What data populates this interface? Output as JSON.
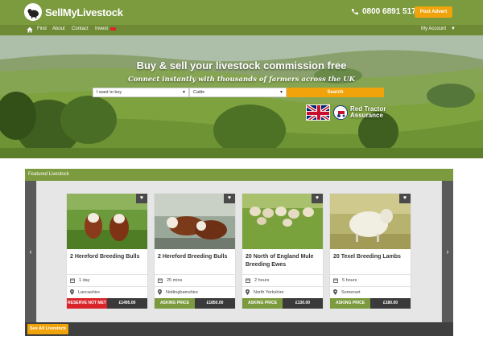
{
  "brand": {
    "name": "SellMyLivestock"
  },
  "header": {
    "phone": "0800 6891 517",
    "post_advert": "Post Advert"
  },
  "nav": {
    "items": [
      {
        "label": "Find"
      },
      {
        "label": "About"
      },
      {
        "label": "Contact"
      },
      {
        "label": "Invest"
      }
    ],
    "account": "My Account"
  },
  "hero": {
    "title": "Buy & sell your livestock commission free",
    "subtitle": "Connect instantly with thousands of farmers across the UK",
    "intent_value": "I want to buy",
    "type_value": "Cattle",
    "search_label": "Search",
    "badge_text": "Red Tractor\nAssurance"
  },
  "featured": {
    "heading": "Featured Livestock",
    "see_all": "See All Livestock",
    "cards": [
      {
        "title": "2 Hereford Breeding Bulls",
        "time": "1 day",
        "location": "Lancashire",
        "price_type": "RESERVE NOT MET",
        "price": "£1495.00",
        "price_type_color": "#d9252a"
      },
      {
        "title": "2 Hereford Breeding Bulls",
        "time": "25 mins",
        "location": "Nottinghamshire",
        "price_type": "ASKING PRICE",
        "price": "£1850.00",
        "price_type_color": "#7c9a3e"
      },
      {
        "title": "20 North of England Mule Breeding Ewes",
        "time": "2 hours",
        "location": "North Yorkshire",
        "price_type": "ASKING PRICE",
        "price": "£130.00",
        "price_type_color": "#7c9a3e"
      },
      {
        "title": "20 Texel Breeding Lambs",
        "time": "5 hours",
        "location": "Somerset",
        "price_type": "ASKING PRICE",
        "price": "£180.00",
        "price_type_color": "#7c9a3e"
      }
    ]
  },
  "colors": {
    "brand_green": "#7c9a3e",
    "accent_orange": "#f0a30a",
    "alert_red": "#d9252a"
  },
  "icons": [
    "home-icon",
    "phone-icon",
    "chevron-down-icon",
    "heart-icon",
    "calendar-icon",
    "map-pin-icon",
    "chevron-left-icon",
    "chevron-right-icon"
  ]
}
